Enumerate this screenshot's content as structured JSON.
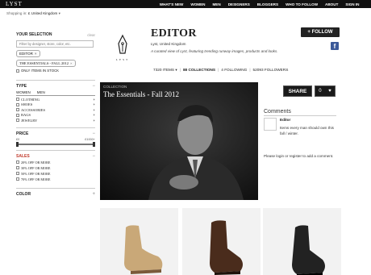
{
  "topbar": {
    "logo": "LYST",
    "nav": [
      "WHAT'S NEW",
      "WOMEN",
      "MEN",
      "DESIGNERS",
      "BLOGGERS",
      "WHO TO FOLLOW",
      "ABOUT",
      "SIGN IN"
    ]
  },
  "shipping": {
    "label": "Shopping in:",
    "value": "£ United Kingdom"
  },
  "sidebar": {
    "your_selection": "YOUR SELECTION",
    "clear": "clear",
    "filter_placeholder": "Filter by designer, store, color, etc.",
    "tags": [
      "EDITOR",
      "THE ESSENTIALS - FALL 2012"
    ],
    "only_in_stock": "ONLY ITEMS IN STOCK",
    "type_head": "TYPE",
    "gender_tabs": [
      "WOMEN",
      "MEN"
    ],
    "categories": [
      "CLOTHING",
      "SHOES",
      "ACCESSORIES",
      "BAGS",
      "JEWELRY"
    ],
    "price_head": "PRICE",
    "price_min": "£0",
    "price_max": "£1000+",
    "sales_head": "SALES",
    "sales": [
      "20% OFF OR MORE",
      "30% OFF OR MORE",
      "50% OFF OR MORE",
      "70% OFF OR MORE"
    ],
    "color_head": "COLOR"
  },
  "profile": {
    "icon_label": "LYST",
    "name": "EDITOR",
    "location": "Lyst, United Kingdom",
    "description": "A curated view of Lyst, featuring trending runway images, products and looks.",
    "follow": "+ FOLLOW",
    "facebook_icon": "f"
  },
  "stats": {
    "items": "7320 ITEMS",
    "collections": "88 COLLECTIONS",
    "following": "4 FOLLOWING",
    "followers": "52093 FOLLOWERS"
  },
  "hero": {
    "label": "COLLECTION",
    "title": "The Essentials - Fall 2012",
    "share": "SHARE",
    "likes": "0"
  },
  "comments": {
    "title": "Comments",
    "user": "Editor",
    "text": "Items every man should own this fall / winter.",
    "login": "Please login or register to add a comment."
  }
}
